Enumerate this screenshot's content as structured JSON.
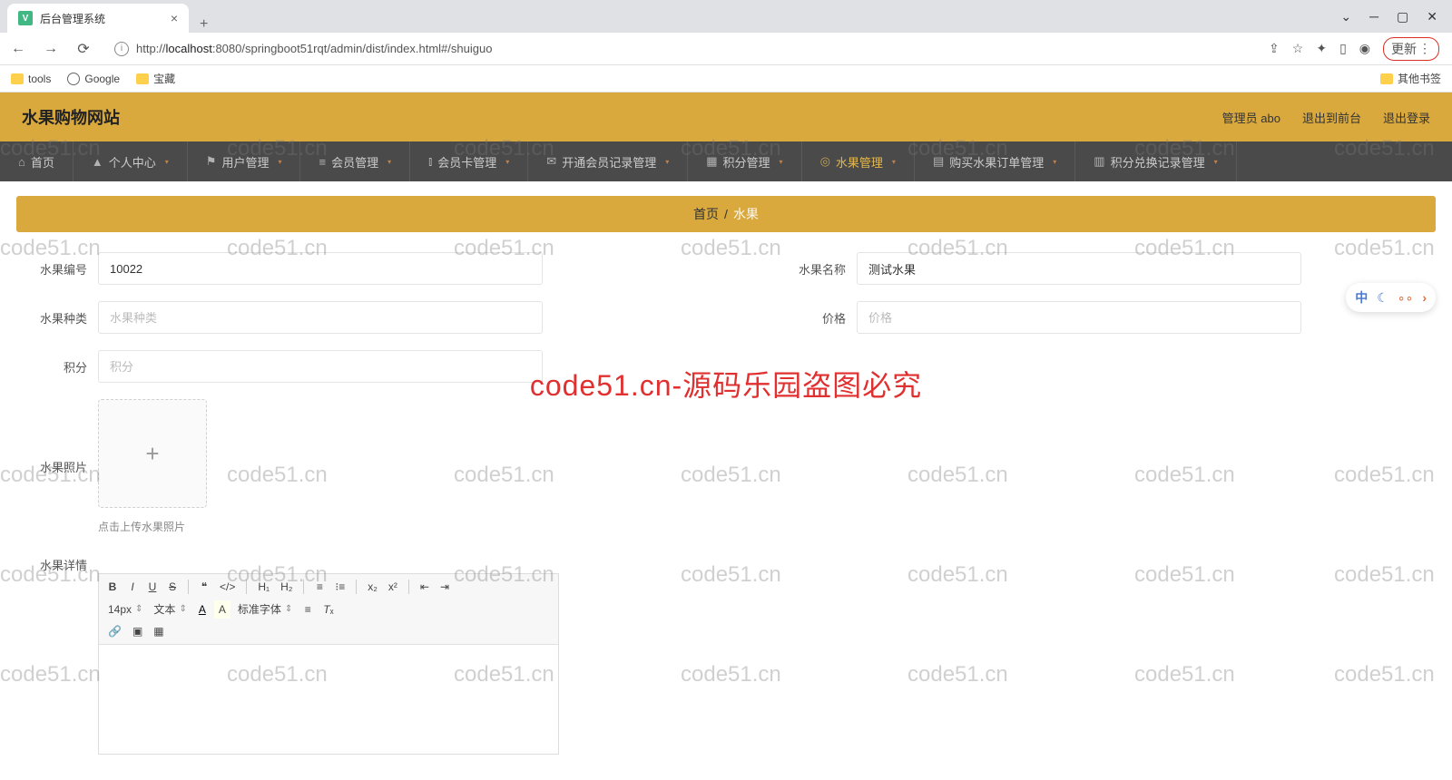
{
  "browser": {
    "tab_title": "后台管理系统",
    "url_prefix": "http://",
    "url_host": "localhost",
    "url_path": ":8080/springboot51rqt/admin/dist/index.html#/shuiguo",
    "update_label": "更新",
    "bookmarks": {
      "tools": "tools",
      "google": "Google",
      "baozang": "宝藏",
      "other": "其他书签"
    }
  },
  "app": {
    "title": "水果购物网站",
    "admin_label": "管理员 abo",
    "logout_front": "退出到前台",
    "logout": "退出登录"
  },
  "nav": {
    "home": "首页",
    "personal": "个人中心",
    "user_mgmt": "用户管理",
    "member_mgmt": "会员管理",
    "card_mgmt": "会员卡管理",
    "open_record": "开通会员记录管理",
    "points_mgmt": "积分管理",
    "fruit_mgmt": "水果管理",
    "order_mgmt": "购买水果订单管理",
    "exchange_mgmt": "积分兑换记录管理"
  },
  "breadcrumb": {
    "home": "首页",
    "current": "水果"
  },
  "form": {
    "id_label": "水果编号",
    "id_value": "10022",
    "name_label": "水果名称",
    "name_value": "测试水果",
    "type_label": "水果种类",
    "type_placeholder": "水果种类",
    "price_label": "价格",
    "price_placeholder": "价格",
    "points_label": "积分",
    "points_placeholder": "积分",
    "photo_label": "水果照片",
    "photo_hint": "点击上传水果照片",
    "detail_label": "水果详情"
  },
  "editor": {
    "fontsize": "14px",
    "texttype": "文本",
    "fontfamily": "标准字体"
  },
  "watermark": {
    "text": "code51.cn",
    "main": "code51.cn-源码乐园盗图必究"
  },
  "floating": {
    "zh": "中"
  }
}
